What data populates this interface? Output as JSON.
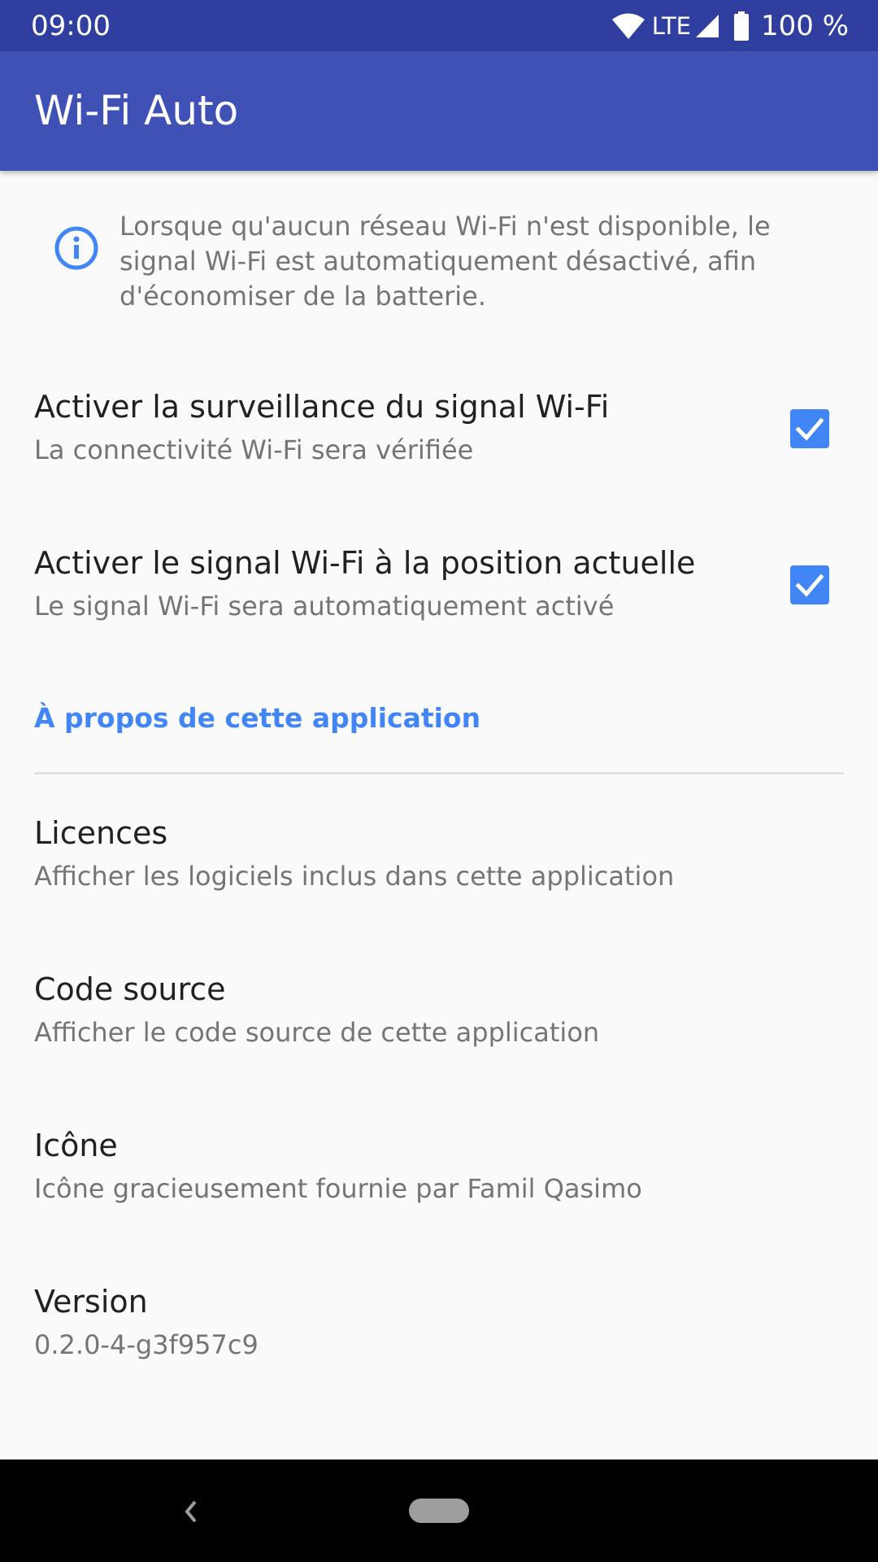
{
  "status_bar": {
    "time": "09:00",
    "network": "LTE",
    "battery": "100 %",
    "icons": [
      "wifi-icon",
      "signal-icon",
      "battery-icon"
    ]
  },
  "app_bar": {
    "title": "Wi-Fi Auto"
  },
  "info": {
    "icon": "info-icon",
    "text": "Lorsque qu'aucun réseau Wi-Fi n'est disponible, le signal Wi-Fi est automatiquement désactivé, afin d'économiser de la batterie."
  },
  "preferences": [
    {
      "title": "Activer la surveillance du signal Wi-Fi",
      "summary": "La connectivité Wi-Fi sera vérifiée",
      "checked": true
    },
    {
      "title": "Activer le signal Wi-Fi à la position actuelle",
      "summary": "Le signal Wi-Fi sera automatiquement activé",
      "checked": true
    }
  ],
  "about": {
    "header": "À propos de cette application",
    "items": [
      {
        "title": "Licences",
        "summary": "Afficher les logiciels inclus dans cette application"
      },
      {
        "title": "Code source",
        "summary": "Afficher le code source de cette application"
      },
      {
        "title": "Icône",
        "summary": "Icône gracieusement fournie par Famil Qasimo"
      },
      {
        "title": "Version",
        "summary": "0.2.0-4-g3f957c9"
      }
    ]
  },
  "nav_bar": {
    "icons": [
      "back-icon",
      "home-pill-icon"
    ]
  },
  "colors": {
    "status_bar": "#303f9f",
    "app_bar": "#3f51b5",
    "accent": "#4285f4",
    "background": "#fafafa"
  }
}
